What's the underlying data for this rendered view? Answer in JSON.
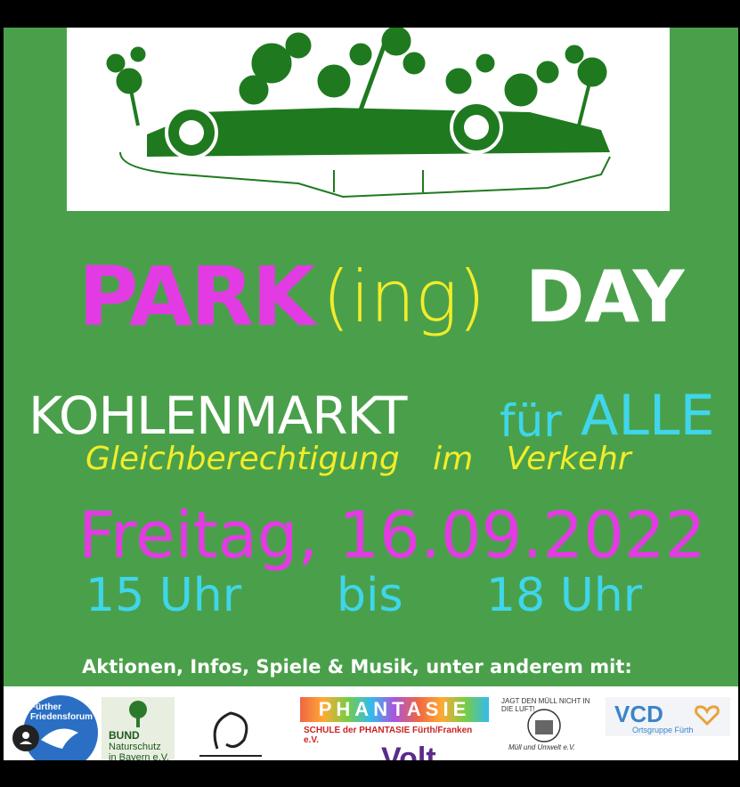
{
  "poster": {
    "title": {
      "park": "PARK",
      "ing": "(ing)",
      "day": "DAY"
    },
    "location": {
      "main": "KOHLENMARKT",
      "fuer": "für",
      "alle": "ALLE"
    },
    "subtitle": "Gleichberechtigung im Verkehr",
    "date": "Freitag, 16.09.2022",
    "time": {
      "start": "15 Uhr",
      "bis": "bis",
      "end": "18 Uhr"
    },
    "aktionen": "Aktionen, Infos, Spiele & Musik, unter anderem mit:"
  },
  "logos": {
    "friedensforum": "Fürther Friedensforum",
    "bund": {
      "line1": "BUND",
      "line2": "Naturschutz",
      "line3": "in Bayern e.V."
    },
    "phantasie": {
      "big": "PHANTASIE",
      "small": "SCHULE der PHANTASIE Fürth/Franken e.V."
    },
    "jagt": {
      "arc": "JAGT DEN MÜLL NICHT IN DIE LUFT!",
      "sub": "Müll und Umwelt e.V."
    },
    "vcd": {
      "name": "VCD",
      "sub": "Ortsgruppe Fürth"
    },
    "volt": "Volt"
  },
  "colors": {
    "background": "#4aa04a",
    "magenta": "#e33be3",
    "yellow": "#f3ec2a",
    "cyan": "#3fd6ec",
    "car_green": "#1f7a1f"
  },
  "icons": {
    "car": "car-with-plants-icon",
    "avatar": "user-avatar-icon"
  }
}
